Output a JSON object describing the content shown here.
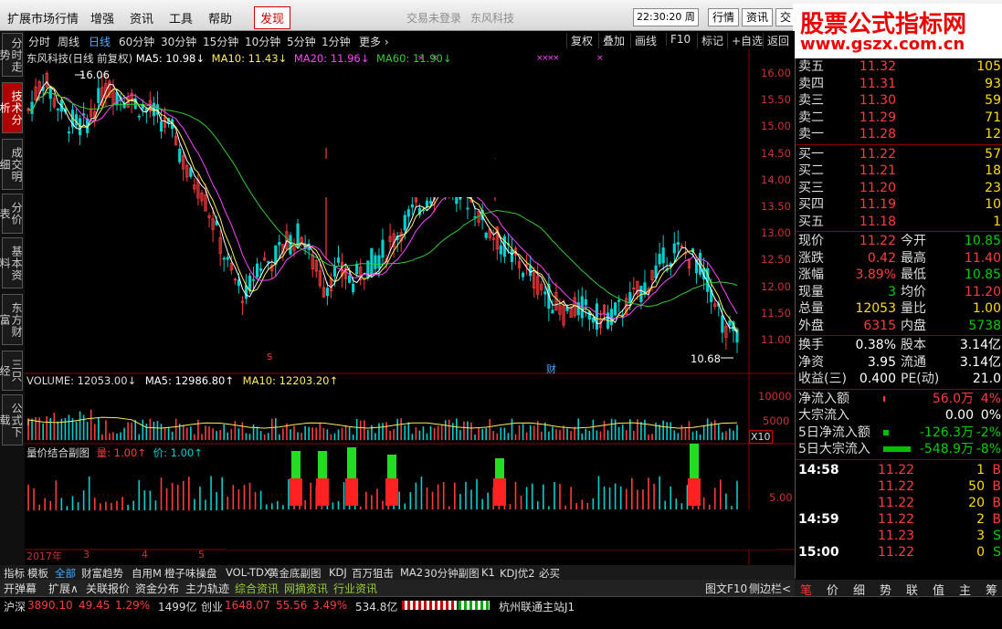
{
  "menubar": {
    "items": [
      "扩展市场行情",
      "增强",
      "资讯",
      "工具",
      "帮助",
      "发现"
    ],
    "active": "发现",
    "center_titles": [
      "交易未登录",
      "东风科技"
    ],
    "clock": "22:30:20 周一",
    "right_buttons": [
      "行情",
      "资讯",
      "交"
    ]
  },
  "brand": {
    "line1": "股票公式指标网",
    "line2": "www.gszx.com.cn"
  },
  "left_tabs": [
    "分时走势",
    "技术分析",
    "成交明细",
    "分价表",
    "基本资料",
    "东方财富",
    "三只经",
    "公式下载"
  ],
  "left_tab_active": "技术分析",
  "period_bar": {
    "items": [
      "分时",
      "周线",
      "日线",
      "60分钟",
      "30分钟",
      "15分钟",
      "10分钟",
      "5分钟",
      "1分钟",
      "更多 ›"
    ],
    "selected": "日线",
    "tools": [
      "复权",
      "叠加",
      "画线",
      "F10",
      "标记",
      "+自选",
      "返回"
    ]
  },
  "main_legend": {
    "name": "东风科技(日线 前复权)",
    "ma5": "MA5: 10.98↓",
    "ma10": "MA10: 11.43↓",
    "ma20": "MA20: 11.96↓",
    "ma60": "MA60: 11.90↓"
  },
  "price_axis": [
    "16.00",
    "15.50",
    "15.00",
    "14.50",
    "14.00",
    "13.50",
    "13.00",
    "12.50",
    "12.00",
    "11.50",
    "11.00"
  ],
  "annotations": {
    "high": "16.06",
    "low": "10.68",
    "cai": "财"
  },
  "volume_legend": {
    "volume": "VOLUME: 12053.00↓",
    "ma5": "MA5: 12986.80↑",
    "ma10": "MA10: 12203.20↑"
  },
  "volume_axis": [
    "10000",
    "5000"
  ],
  "volume_unit": "X10",
  "qty_legend": {
    "title": "量价结合副图",
    "liang": "量: 1.00↑",
    "jia": "价: 1.00↑"
  },
  "qty_axis": "5.00",
  "date_labels": [
    "2017年",
    "3",
    "4",
    "5"
  ],
  "indicator_tabs": [
    "指标",
    "模板",
    "全部",
    "财富趋势",
    "自用M",
    "橙子味操盘",
    "VOL-TDX",
    "黄金底副图",
    "KDJ",
    "百万狙击",
    "MA2",
    "30分钟副图",
    "K1",
    "KDJ优2",
    "必买"
  ],
  "indicator_selected": "全部",
  "func_bar": [
    "开弹幕",
    "扩展∧",
    "关联报价",
    "资金分布",
    "主力轨迹",
    "综合资讯",
    "网摘资讯",
    "行业资讯"
  ],
  "func_bar_right": [
    "图文F10",
    "侧边栏<"
  ],
  "status_bar": {
    "sh_label": "沪深",
    "sh_index": "3890.10",
    "sh_chg": "49.45",
    "sh_pct": "1.29%",
    "sh_amt": "1499亿",
    "cy_label": "创业",
    "cy_index": "1648.07",
    "cy_chg": "55.56",
    "cy_pct": "3.49%",
    "cy_amt": "534.8亿",
    "server": "杭州联通主站J1"
  },
  "order_book": {
    "asks": [
      {
        "label": "卖五",
        "price": "11.32",
        "qty": "105"
      },
      {
        "label": "卖四",
        "price": "11.31",
        "qty": "93"
      },
      {
        "label": "卖三",
        "price": "11.30",
        "qty": "59"
      },
      {
        "label": "卖二",
        "price": "11.29",
        "qty": "71"
      },
      {
        "label": "卖一",
        "price": "11.28",
        "qty": "12"
      }
    ],
    "bids": [
      {
        "label": "买一",
        "price": "11.22",
        "qty": "57"
      },
      {
        "label": "买二",
        "price": "11.21",
        "qty": "18"
      },
      {
        "label": "买三",
        "price": "11.20",
        "qty": "23"
      },
      {
        "label": "买四",
        "price": "11.19",
        "qty": "10"
      },
      {
        "label": "买五",
        "price": "11.18",
        "qty": "1"
      }
    ]
  },
  "quote": [
    {
      "l1": "现价",
      "v1": "11.22",
      "c1": "red",
      "l2": "今开",
      "v2": "10.85",
      "c2": "grn"
    },
    {
      "l1": "涨跌",
      "v1": "0.42",
      "c1": "red",
      "l2": "最高",
      "v2": "11.40",
      "c2": "red"
    },
    {
      "l1": "涨幅",
      "v1": "3.89%",
      "c1": "red",
      "l2": "最低",
      "v2": "10.85",
      "c2": "grn"
    },
    {
      "l1": "现量",
      "v1": "3",
      "c1": "grn",
      "l2": "均价",
      "v2": "11.20",
      "c2": "red"
    },
    {
      "l1": "总量",
      "v1": "12053",
      "c1": "yel",
      "l2": "量比",
      "v2": "1.00",
      "c2": "yel"
    },
    {
      "l1": "外盘",
      "v1": "6315",
      "c1": "red",
      "l2": "内盘",
      "v2": "5738",
      "c2": "grn"
    }
  ],
  "fundamentals": [
    {
      "l1": "换手",
      "v1": "0.38%",
      "l2": "股本",
      "v2": "3.14亿"
    },
    {
      "l1": "净资",
      "v1": "3.95",
      "l2": "流通",
      "v2": "3.14亿"
    },
    {
      "l1": "收益(三)",
      "v1": "0.400",
      "l2": "PE(动)",
      "v2": "21.0"
    }
  ],
  "flows": [
    {
      "label": "净流入额",
      "value": "56.0万",
      "pct": "4%",
      "color": "red"
    },
    {
      "label": "大宗流入",
      "value": "0.00",
      "pct": "0%",
      "color": "wht"
    },
    {
      "label": "5日净流入额",
      "value": "-126.3万",
      "pct": "-2%",
      "color": "grn"
    },
    {
      "label": "5日大宗流入",
      "value": "-548.9万",
      "pct": "-8%",
      "color": "grn"
    }
  ],
  "ticks": [
    {
      "time": "14:58",
      "price": "11.22",
      "qty": "1",
      "side": "B"
    },
    {
      "time": "",
      "price": "11.22",
      "qty": "50",
      "side": "B"
    },
    {
      "time": "",
      "price": "11.22",
      "qty": "20",
      "side": "B"
    },
    {
      "time": "14:59",
      "price": "11.22",
      "qty": "2",
      "side": "B"
    },
    {
      "time": "",
      "price": "11.23",
      "qty": "3",
      "side": "S"
    },
    {
      "time": "15:00",
      "price": "11.22",
      "qty": "0",
      "side": "S"
    }
  ],
  "right_tabs": [
    "笔",
    "价",
    "细",
    "势",
    "联",
    "值",
    "主",
    "筹"
  ],
  "right_tab_selected": "笔",
  "colors": {
    "up": "#ff3c3c",
    "down": "#00d0d0",
    "ma5": "#ffffff",
    "ma10": "#ffee55",
    "ma20": "#ff44ff",
    "ma60": "#33cc33"
  }
}
